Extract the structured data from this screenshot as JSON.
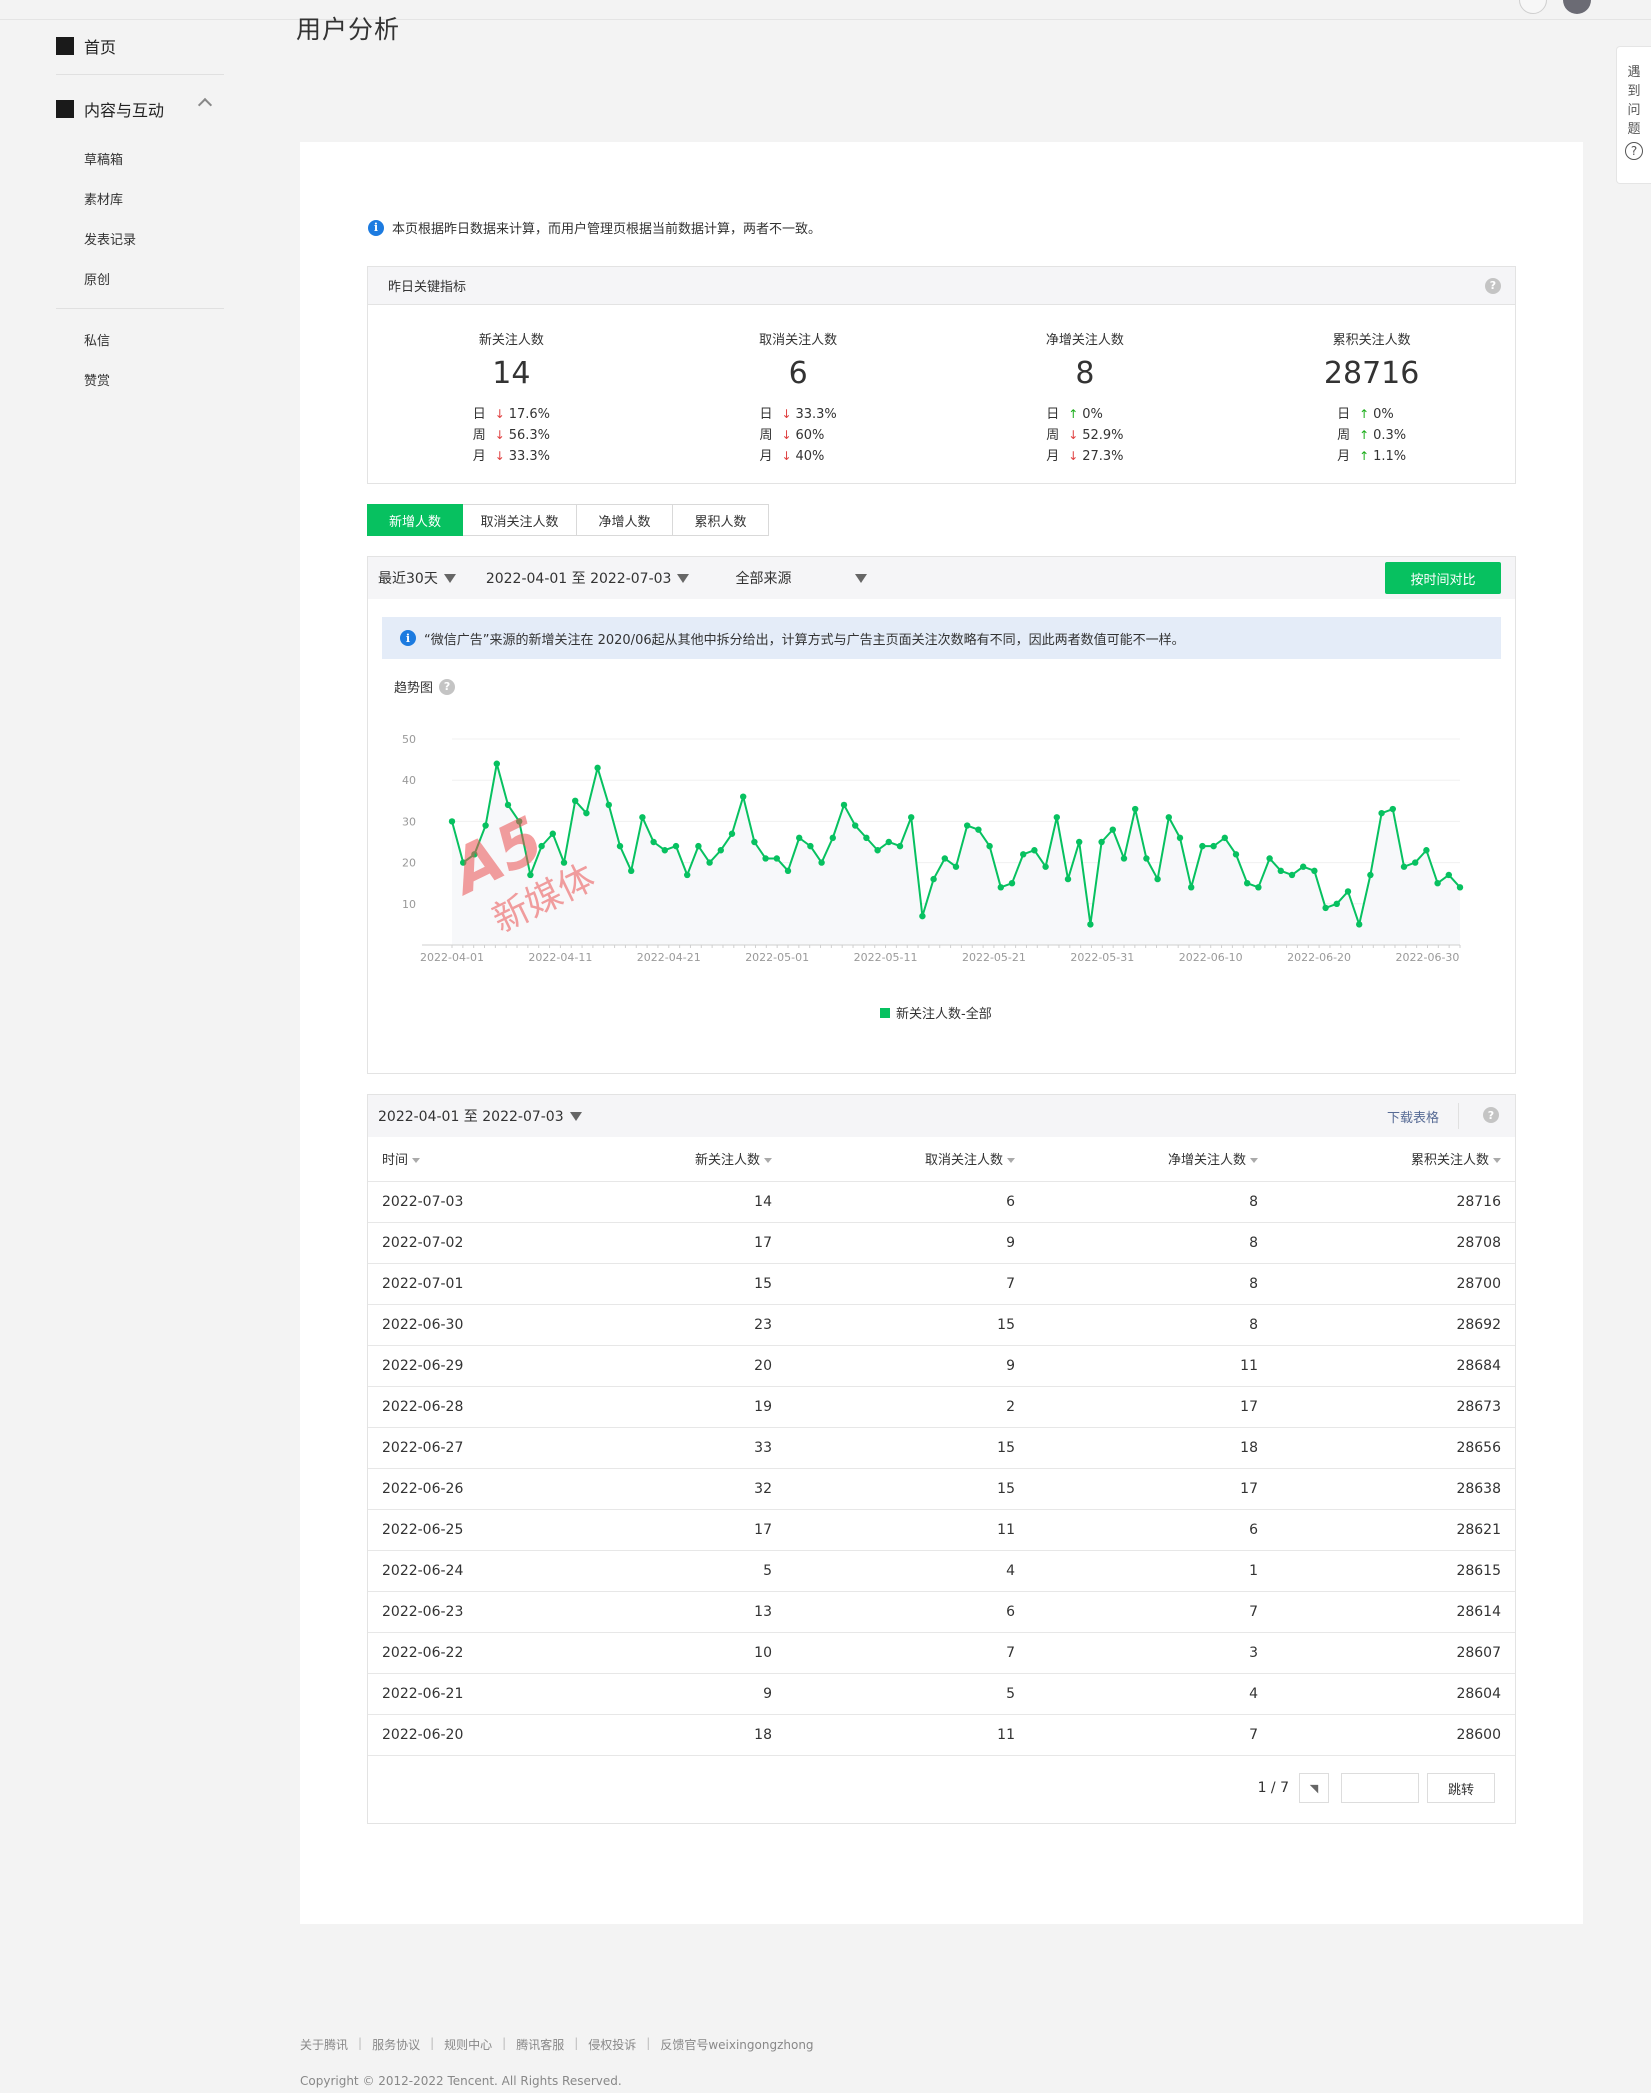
{
  "page_title": "用户分析",
  "sidebar": {
    "home": "首页",
    "content": "内容与互动",
    "sub_items": [
      "草稿箱",
      "素材库",
      "发表记录",
      "原创"
    ],
    "sub_items2": [
      "私信",
      "赞赏"
    ]
  },
  "help_tab": {
    "chars": [
      "遇",
      "到",
      "问",
      "题"
    ],
    "icon": "?"
  },
  "notice_text": "本页根据昨日数据来计算，而用户管理页根据当前数据计算，两者不一致。",
  "kpi": {
    "header": "昨日关键指标",
    "period_labels": [
      "日",
      "周",
      "月"
    ],
    "items": [
      {
        "label": "新关注人数",
        "value": "14",
        "changes": [
          {
            "dir": "down",
            "pct": "17.6%"
          },
          {
            "dir": "down",
            "pct": "56.3%"
          },
          {
            "dir": "down",
            "pct": "33.3%"
          }
        ]
      },
      {
        "label": "取消关注人数",
        "value": "6",
        "changes": [
          {
            "dir": "down",
            "pct": "33.3%"
          },
          {
            "dir": "down",
            "pct": "60%"
          },
          {
            "dir": "down",
            "pct": "40%"
          }
        ]
      },
      {
        "label": "净增关注人数",
        "value": "8",
        "changes": [
          {
            "dir": "up",
            "pct": "0%"
          },
          {
            "dir": "down",
            "pct": "52.9%"
          },
          {
            "dir": "down",
            "pct": "27.3%"
          }
        ]
      },
      {
        "label": "累积关注人数",
        "value": "28716",
        "changes": [
          {
            "dir": "up",
            "pct": "0%"
          },
          {
            "dir": "up",
            "pct": "0.3%"
          },
          {
            "dir": "up",
            "pct": "1.1%"
          }
        ]
      }
    ]
  },
  "tabs": [
    "新增人数",
    "取消关注人数",
    "净增人数",
    "累积人数"
  ],
  "filter": {
    "range": "最近30天",
    "dates": "2022-04-01 至 2022-07-03",
    "source": "全部来源",
    "compare_button": "按时间对比"
  },
  "blue_notice": "“微信广告”来源的新增关注在 2020/06起从其他中拆分给出，计算方式与广告主页面关注次数略有不同，因此两者数值可能不一样。",
  "trend_label": "趋势图",
  "chart_data": {
    "type": "line",
    "y_ticks": [
      10,
      20,
      30,
      40,
      50
    ],
    "ylim": [
      0,
      50
    ],
    "x_ticks": [
      "2022-04-01",
      "2022-04-11",
      "2022-04-21",
      "2022-05-01",
      "2022-05-11",
      "2022-05-21",
      "2022-05-31",
      "2022-06-10",
      "2022-06-20",
      "2022-06-30"
    ],
    "x_start": "2022-04-01",
    "x_end": "2022-07-03",
    "series": [
      {
        "name": "新关注人数-全部",
        "color": "#07c160",
        "values": [
          30,
          20,
          22,
          29,
          44,
          34,
          30,
          17,
          24,
          27,
          20,
          35,
          32,
          43,
          34,
          24,
          18,
          31,
          25,
          23,
          24,
          17,
          24,
          20,
          23,
          27,
          36,
          25,
          21,
          21,
          18,
          26,
          24,
          20,
          26,
          34,
          29,
          26,
          23,
          25,
          24,
          31,
          7,
          16,
          21,
          19,
          29,
          28,
          24,
          14,
          15,
          22,
          23,
          19,
          31,
          16,
          25,
          5,
          25,
          28,
          21,
          33,
          21,
          16,
          31,
          26,
          14,
          24,
          24,
          26,
          22,
          15,
          14,
          21,
          18,
          17,
          19,
          18,
          9,
          10,
          13,
          5,
          17,
          32,
          33,
          19,
          20,
          23,
          15,
          17,
          14
        ]
      }
    ]
  },
  "table": {
    "date_range": "2022-04-01 至 2022-07-03",
    "download": "下载表格",
    "columns": [
      "时间",
      "新关注人数",
      "取消关注人数",
      "净增关注人数",
      "累积关注人数"
    ],
    "rows": [
      [
        "2022-07-03",
        "14",
        "6",
        "8",
        "28716"
      ],
      [
        "2022-07-02",
        "17",
        "9",
        "8",
        "28708"
      ],
      [
        "2022-07-01",
        "15",
        "7",
        "8",
        "28700"
      ],
      [
        "2022-06-30",
        "23",
        "15",
        "8",
        "28692"
      ],
      [
        "2022-06-29",
        "20",
        "9",
        "11",
        "28684"
      ],
      [
        "2022-06-28",
        "19",
        "2",
        "17",
        "28673"
      ],
      [
        "2022-06-27",
        "33",
        "15",
        "18",
        "28656"
      ],
      [
        "2022-06-26",
        "32",
        "15",
        "17",
        "28638"
      ],
      [
        "2022-06-25",
        "17",
        "11",
        "6",
        "28621"
      ],
      [
        "2022-06-24",
        "5",
        "4",
        "1",
        "28615"
      ],
      [
        "2022-06-23",
        "13",
        "6",
        "7",
        "28614"
      ],
      [
        "2022-06-22",
        "10",
        "7",
        "3",
        "28607"
      ],
      [
        "2022-06-21",
        "9",
        "5",
        "4",
        "28604"
      ],
      [
        "2022-06-20",
        "18",
        "11",
        "7",
        "28600"
      ]
    ]
  },
  "pager": {
    "info": "1 / 7",
    "jump_button": "跳转"
  },
  "watermark": {
    "logo": "A5",
    "text": "新媒体"
  },
  "footer": {
    "links": [
      "关于腾讯",
      "服务协议",
      "规则中心",
      "腾讯客服",
      "侵权投诉",
      "反馈官号weixingongzhong"
    ],
    "copyright": "Copyright © 2012-2022 Tencent. All Rights Reserved."
  }
}
